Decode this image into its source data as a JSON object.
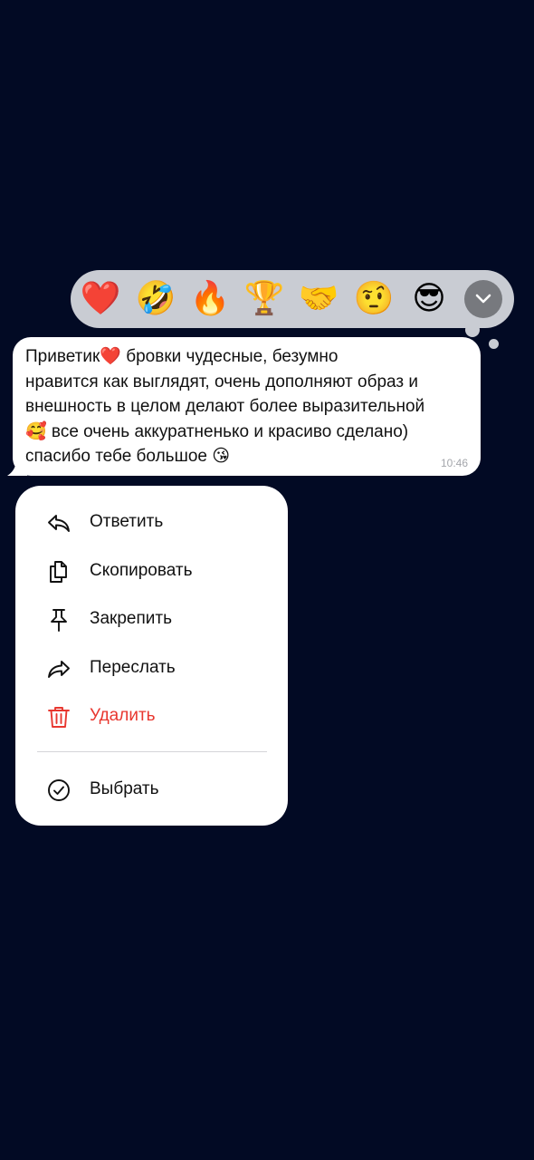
{
  "reactions": [
    {
      "icon": "red-heart",
      "glyph": "❤️"
    },
    {
      "icon": "rolling-on-floor-laughing",
      "glyph": "🤣"
    },
    {
      "icon": "fire",
      "glyph": "🔥"
    },
    {
      "icon": "trophy",
      "glyph": "🏆"
    },
    {
      "icon": "handshake",
      "glyph": "🤝"
    },
    {
      "icon": "face-with-raised-eyebrow",
      "glyph": "🤨"
    },
    {
      "icon": "smiling-face-with-sunglasses",
      "glyph": "😎"
    }
  ],
  "reaction_bar": {
    "expand_icon": "chevron-down",
    "color": "#c9ccd3"
  },
  "message": {
    "text": "Приветик❤️ бровки чудесные, безумно\nнравится как выглядят, очень дополняют образ и\nвнешность в целом делают более выразительной\n🥰 все очень аккуратненько и красиво сделано)\nспасибо тебе большое 😘",
    "time": "10:46"
  },
  "menu": {
    "reply": {
      "label": "Ответить",
      "icon": "reply-arrow"
    },
    "copy": {
      "label": "Скопировать",
      "icon": "copy-documents"
    },
    "pin": {
      "label": "Закрепить",
      "icon": "pin"
    },
    "forward": {
      "label": "Переслать",
      "icon": "forward-arrow"
    },
    "delete": {
      "label": "Удалить",
      "icon": "trash",
      "color": "#e8372f"
    },
    "select": {
      "label": "Выбрать",
      "icon": "check-circle"
    }
  },
  "colors": {
    "background": "#020a24",
    "bubble": "#ffffff",
    "danger": "#e8372f"
  }
}
